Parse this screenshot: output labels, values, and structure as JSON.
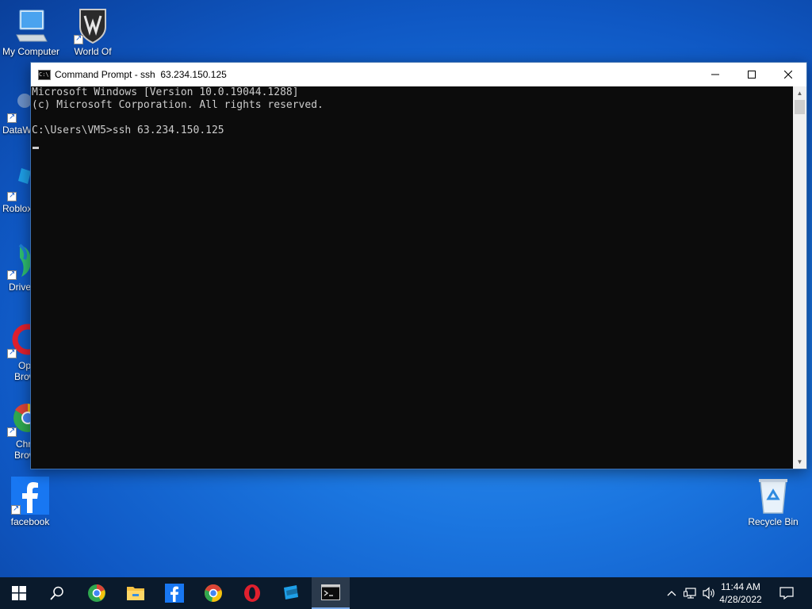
{
  "desktop": {
    "icons": [
      {
        "label": "My Computer",
        "icon": "monitor-icon"
      },
      {
        "label": "World Of",
        "icon": "world-of-tanks-icon"
      },
      {
        "label": "DataW",
        "icon": "datawin-icon"
      },
      {
        "label": "Roblox",
        "icon": "roblox-icon"
      },
      {
        "label": "Drive",
        "icon": "drive-icon"
      },
      {
        "label": "Op",
        "label2": "Brow",
        "icon": "opera-browser-icon"
      },
      {
        "label": "Chr",
        "label2": "Brow",
        "icon": "chrome-browser-icon"
      },
      {
        "label": "facebook",
        "icon": "facebook-icon"
      },
      {
        "label": "Recycle Bin",
        "icon": "recycle-bin-icon"
      }
    ]
  },
  "window": {
    "title": "Command Prompt - ssh  63.234.150.125",
    "icon": "cmd-icon",
    "lines": [
      "Microsoft Windows [Version 10.0.19044.1288]",
      "(c) Microsoft Corporation. All rights reserved.",
      "",
      "C:\\Users\\VM5>ssh 63.234.150.125"
    ]
  },
  "taskbar": {
    "items": [
      "start-icon",
      "search-icon",
      "chrome-icon",
      "file-explorer-icon",
      "facebook-icon",
      "chrome-alt-icon",
      "opera-icon",
      "roblox-studio-icon",
      "cmd-icon"
    ],
    "time": "11:44 AM",
    "date": "4/28/2022"
  },
  "colors": {
    "console_bg": "#0c0c0c",
    "console_text": "#cccccc",
    "taskbar_bg": "#0a1a2c",
    "desktop_accent": "#1b76e0"
  }
}
